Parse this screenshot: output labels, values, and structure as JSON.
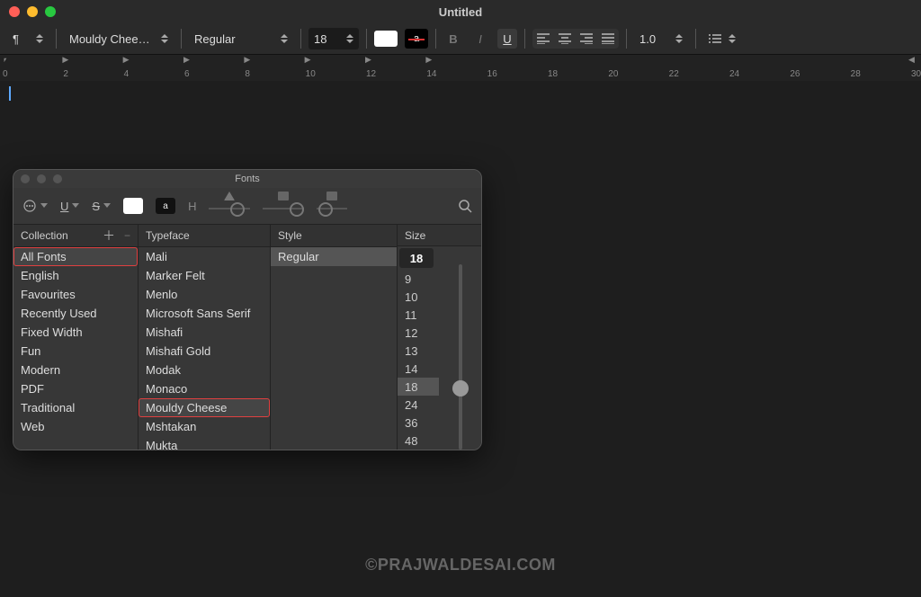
{
  "window": {
    "title": "Untitled"
  },
  "traffic_colors": {
    "close": "#ff5f57",
    "min": "#febc2e",
    "max": "#28c840"
  },
  "toolbar": {
    "para_icon": "¶",
    "font_name": "Mouldy Chee…",
    "font_style": "Regular",
    "font_size": "18",
    "line_spacing": "1.0",
    "style_buttons": {
      "bold": "B",
      "italic": "I",
      "underline": "U"
    }
  },
  "ruler": {
    "labels": [
      "0",
      "2",
      "4",
      "6",
      "8",
      "10",
      "12",
      "14",
      "16",
      "18",
      "20",
      "22",
      "24",
      "26",
      "28",
      "30"
    ]
  },
  "watermark": "©PRAJWALDESAI.COM",
  "fonts_panel": {
    "title": "Fonts",
    "tool_letters": {
      "u": "U",
      "s": "S",
      "a": "a",
      "h": "H"
    },
    "headers": {
      "collection": "Collection",
      "typeface": "Typeface",
      "style": "Style",
      "size": "Size"
    },
    "collections": [
      "All Fonts",
      "English",
      "Favourites",
      "Recently Used",
      "Fixed Width",
      "Fun",
      "Modern",
      "PDF",
      "Traditional",
      "Web"
    ],
    "collection_highlight_index": 0,
    "typefaces": [
      "Mali",
      "Marker Felt",
      "Menlo",
      "Microsoft Sans Serif",
      "Mishafi",
      "Mishafi Gold",
      "Modak",
      "Monaco",
      "Mouldy Cheese",
      "Mshtakan",
      "Mukta"
    ],
    "typeface_highlight_index": 8,
    "styles": [
      "Regular"
    ],
    "style_selected_index": 0,
    "size_input": "18",
    "sizes": [
      "9",
      "10",
      "11",
      "12",
      "13",
      "14",
      "18",
      "24",
      "36",
      "48"
    ],
    "size_selected_index": 6
  }
}
